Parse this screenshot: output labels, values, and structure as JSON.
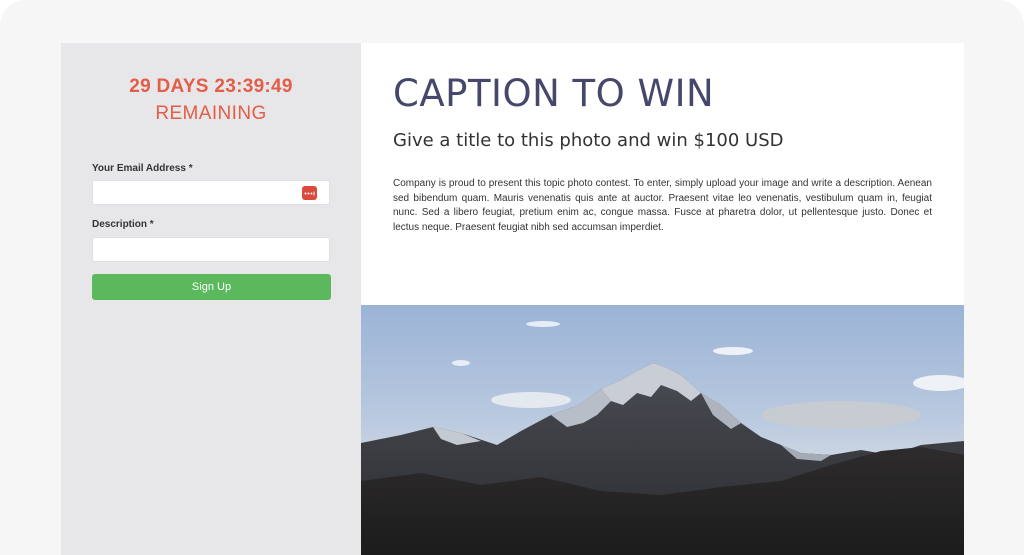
{
  "countdown": {
    "time": "29 DAYS 23:39:49",
    "remaining": "REMAINING"
  },
  "form": {
    "email_label": "Your Email Address *",
    "description_label": "Description *",
    "signup_label": "Sign Up",
    "accent_color": "#5cb85c",
    "icon": "password-manager-icon"
  },
  "contest": {
    "title": "CAPTION TO WIN",
    "subtitle": "Give a title to this photo and win $100 USD",
    "body": "Company is proud to present this topic photo contest. To enter, simply upload your image and write a description. Aenean sed bibendum quam. Mauris venenatis quis ante at auctor. Praesent vitae leo venenatis, vestibulum quam in, feugiat nunc. Sed a libero feugiat, pretium enim ac, congue massa. Fusce at pharetra dolor, ut pellentesque justo. Donec et lectus neque. Praesent feugiat nibh sed accumsan imperdiet."
  }
}
